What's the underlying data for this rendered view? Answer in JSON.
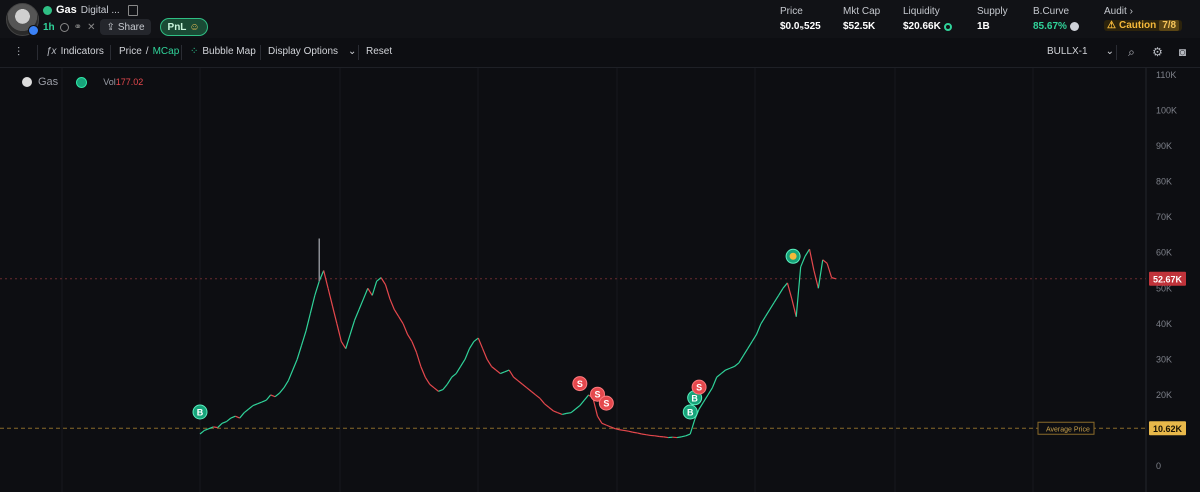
{
  "token": {
    "symbol": "Gas",
    "name": "Digital ...",
    "age": "1h",
    "share_label": "Share",
    "pnl_label": "PnL"
  },
  "stats": {
    "price": {
      "label": "Price",
      "value": "$0.0₅525"
    },
    "mcap": {
      "label": "Mkt Cap",
      "value": "$52.5K"
    },
    "liquidity": {
      "label": "Liquidity",
      "value": "$20.66K"
    },
    "supply": {
      "label": "Supply",
      "value": "1B"
    },
    "bcurve": {
      "label": "B.Curve",
      "value": "85.67%"
    },
    "audit": {
      "label": "Audit",
      "status": "Caution",
      "count": "7/8"
    }
  },
  "toolbar": {
    "indicators": "Indicators",
    "price": "Price",
    "slash": "/",
    "mcap": "MCap",
    "bubble_map": "Bubble Map",
    "display_options": "Display Options",
    "reset": "Reset",
    "bot": "BULLX-1"
  },
  "legend": {
    "symbol": "Gas",
    "vol_label": "Vol",
    "vol_value": "177.02"
  },
  "chart_data": {
    "type": "line",
    "y_axis_ticks": [
      "0",
      "10K",
      "20K",
      "30K",
      "40K",
      "50K",
      "60K",
      "70K",
      "80K",
      "90K",
      "100K",
      "110K"
    ],
    "ylim": [
      0,
      110000
    ],
    "current_value": 52670,
    "current_label": "52.67K",
    "average_price_value": 10620,
    "average_price_label": "10.62K",
    "average_price_text": "Average Price",
    "series": [
      {
        "values": [
          9000,
          10000,
          10500,
          11000,
          10800,
          12000,
          12500,
          13500,
          14000,
          13500,
          15000,
          16000,
          17000,
          17500,
          18000,
          18500,
          20000,
          19500,
          20500,
          22000,
          24000,
          27000,
          30000,
          34000,
          38000,
          43000,
          48000,
          52000,
          55000,
          50000,
          45000,
          40000,
          35000,
          33000,
          37000,
          41000,
          44000,
          47000,
          50000,
          48000,
          52000,
          53000,
          51000,
          47000,
          44000,
          42000,
          40000,
          37000,
          35000,
          32000,
          28000,
          25000,
          23000,
          22000,
          21000,
          21500,
          23000,
          25000,
          26000,
          28000,
          30000,
          33000,
          35000,
          36000,
          33000,
          30000,
          28000,
          27000,
          26000,
          26500,
          27000,
          25000,
          24000,
          23000,
          22000,
          21000,
          20000,
          19000,
          17500,
          16500,
          15500,
          15000,
          14500,
          14800,
          15000,
          16000,
          17000,
          18500,
          20000,
          19000,
          14000,
          12000,
          11500,
          11000,
          10500,
          10200,
          10000,
          9800,
          9500,
          9300,
          9000,
          8800,
          8600,
          8500,
          8300,
          8200,
          8000,
          8100,
          8000,
          8200,
          8500,
          9000,
          13000,
          16000,
          18000,
          20000,
          22000,
          25000,
          26000,
          27000,
          27500,
          28000,
          29000,
          31000,
          33000,
          35000,
          37000,
          40000,
          42000,
          44000,
          46000,
          48000,
          50000,
          51500,
          47000,
          42000,
          56000,
          59000,
          61000,
          55000,
          50000,
          58000,
          57000,
          53000,
          52670
        ]
      }
    ],
    "markers": [
      {
        "type": "B",
        "index": 0
      },
      {
        "type": "S",
        "index": 86
      },
      {
        "type": "S",
        "index": 90
      },
      {
        "type": "S",
        "index": 92
      },
      {
        "type": "B",
        "index": 111
      },
      {
        "type": "B",
        "index": 112
      },
      {
        "type": "S",
        "index": 113
      },
      {
        "type": "emoji",
        "index": 137
      }
    ]
  },
  "colors": {
    "up": "#30d39a",
    "down": "#e5484d",
    "marker_b": "#17a37a",
    "marker_s": "#e5484d",
    "avg": "#f5b93a"
  },
  "icons": [
    "chain-icon",
    "copy-icon",
    "globe-icon",
    "link-icon",
    "x-icon",
    "share-icon",
    "eye-icon",
    "candle-type-icon",
    "fx-icon",
    "bubble-icon",
    "chevron-down-icon",
    "search-icon",
    "settings-icon",
    "camera-icon"
  ]
}
